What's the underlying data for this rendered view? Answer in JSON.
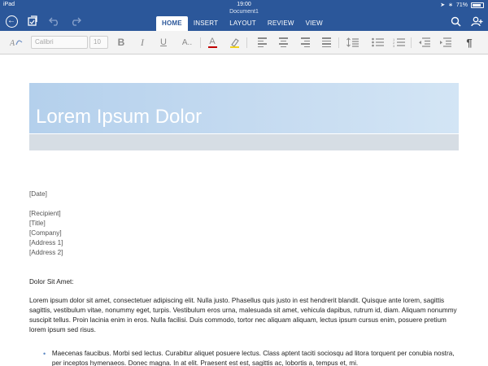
{
  "status_bar": {
    "carrier": "iPad",
    "time": "19:00",
    "battery": "71%"
  },
  "ribbon": {
    "document_title": "Document1",
    "tabs": [
      {
        "label": "HOME",
        "active": true
      },
      {
        "label": "INSERT",
        "active": false
      },
      {
        "label": "LAYOUT",
        "active": false
      },
      {
        "label": "REVIEW",
        "active": false
      },
      {
        "label": "VIEW",
        "active": false
      }
    ],
    "icons": [
      "back-icon",
      "save-icon",
      "undo-icon",
      "redo-icon",
      "search-icon",
      "share-user-icon"
    ]
  },
  "toolbar": {
    "font_name": "Calibri",
    "font_size": "10",
    "bold_glyph": "B",
    "italic_glyph": "I",
    "underline_glyph": "U",
    "font_effects_glyph": "A..",
    "font_color_glyph": "A",
    "pilcrow_glyph": "¶"
  },
  "document": {
    "banner_title": "Lorem Ipsum Dolor",
    "date": "[Date]",
    "recipient_lines": [
      "[Recipient]",
      "[Title]",
      "[Company]",
      "[Address 1]",
      "[Address 2]"
    ],
    "salutation": "Dolor Sit Amet:",
    "body_paragraph": "Lorem ipsum dolor sit amet, consectetuer adipiscing elit. Nulla justo. Phasellus quis justo in est hendrerit blandit. Quisque ante lorem, sagittis sagittis, vestibulum vitae, nonummy eget, turpis. Vestibulum eros urna, malesuada sit amet, vehicula dapibus, rutrum id, diam. Aliquam nonummy suscipit tellus. Proin lacinia enim in eros. Nulla facilisi. Duis commodo, tortor nec aliquam aliquam, lectus ipsum cursus enim, posuere pretium lorem ipsum sed risus.",
    "bullet_item": "Maecenas faucibus. Morbi sed lectus. Curabitur aliquet posuere lectus. Class aptent taciti sociosqu ad litora torquent per conubia nostra, per inceptos hymenaeos. Donec magna. In at elit. Praesent est est, sagittis ac, lobortis a, tempus et, mi."
  },
  "colors": {
    "ribbon": "#2b579a",
    "toolbar": "#f3f3f3",
    "banner": "#c7dcf1",
    "band": "#d6dde4",
    "bullet": "#5b88c3"
  }
}
